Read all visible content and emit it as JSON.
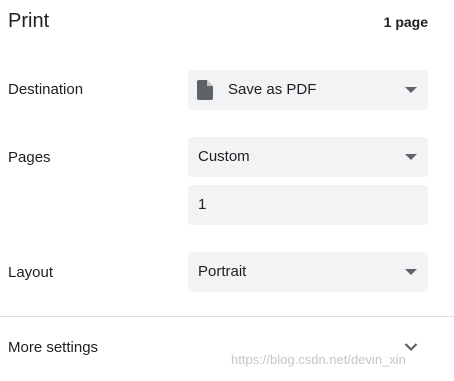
{
  "header": {
    "title": "Print",
    "page_count": "1 page"
  },
  "destination": {
    "label": "Destination",
    "value": "Save as PDF",
    "icon": "document-icon"
  },
  "pages": {
    "label": "Pages",
    "value": "Custom",
    "custom_range": "1"
  },
  "layout": {
    "label": "Layout",
    "value": "Portrait"
  },
  "more_settings": {
    "label": "More settings",
    "icon": "chevron-down-icon"
  },
  "watermark": "https://blog.csdn.net/devin_xin",
  "colors": {
    "field_background": "#f1f3f4",
    "text": "#202124",
    "icon": "#5f6368",
    "divider": "#dadce0"
  }
}
